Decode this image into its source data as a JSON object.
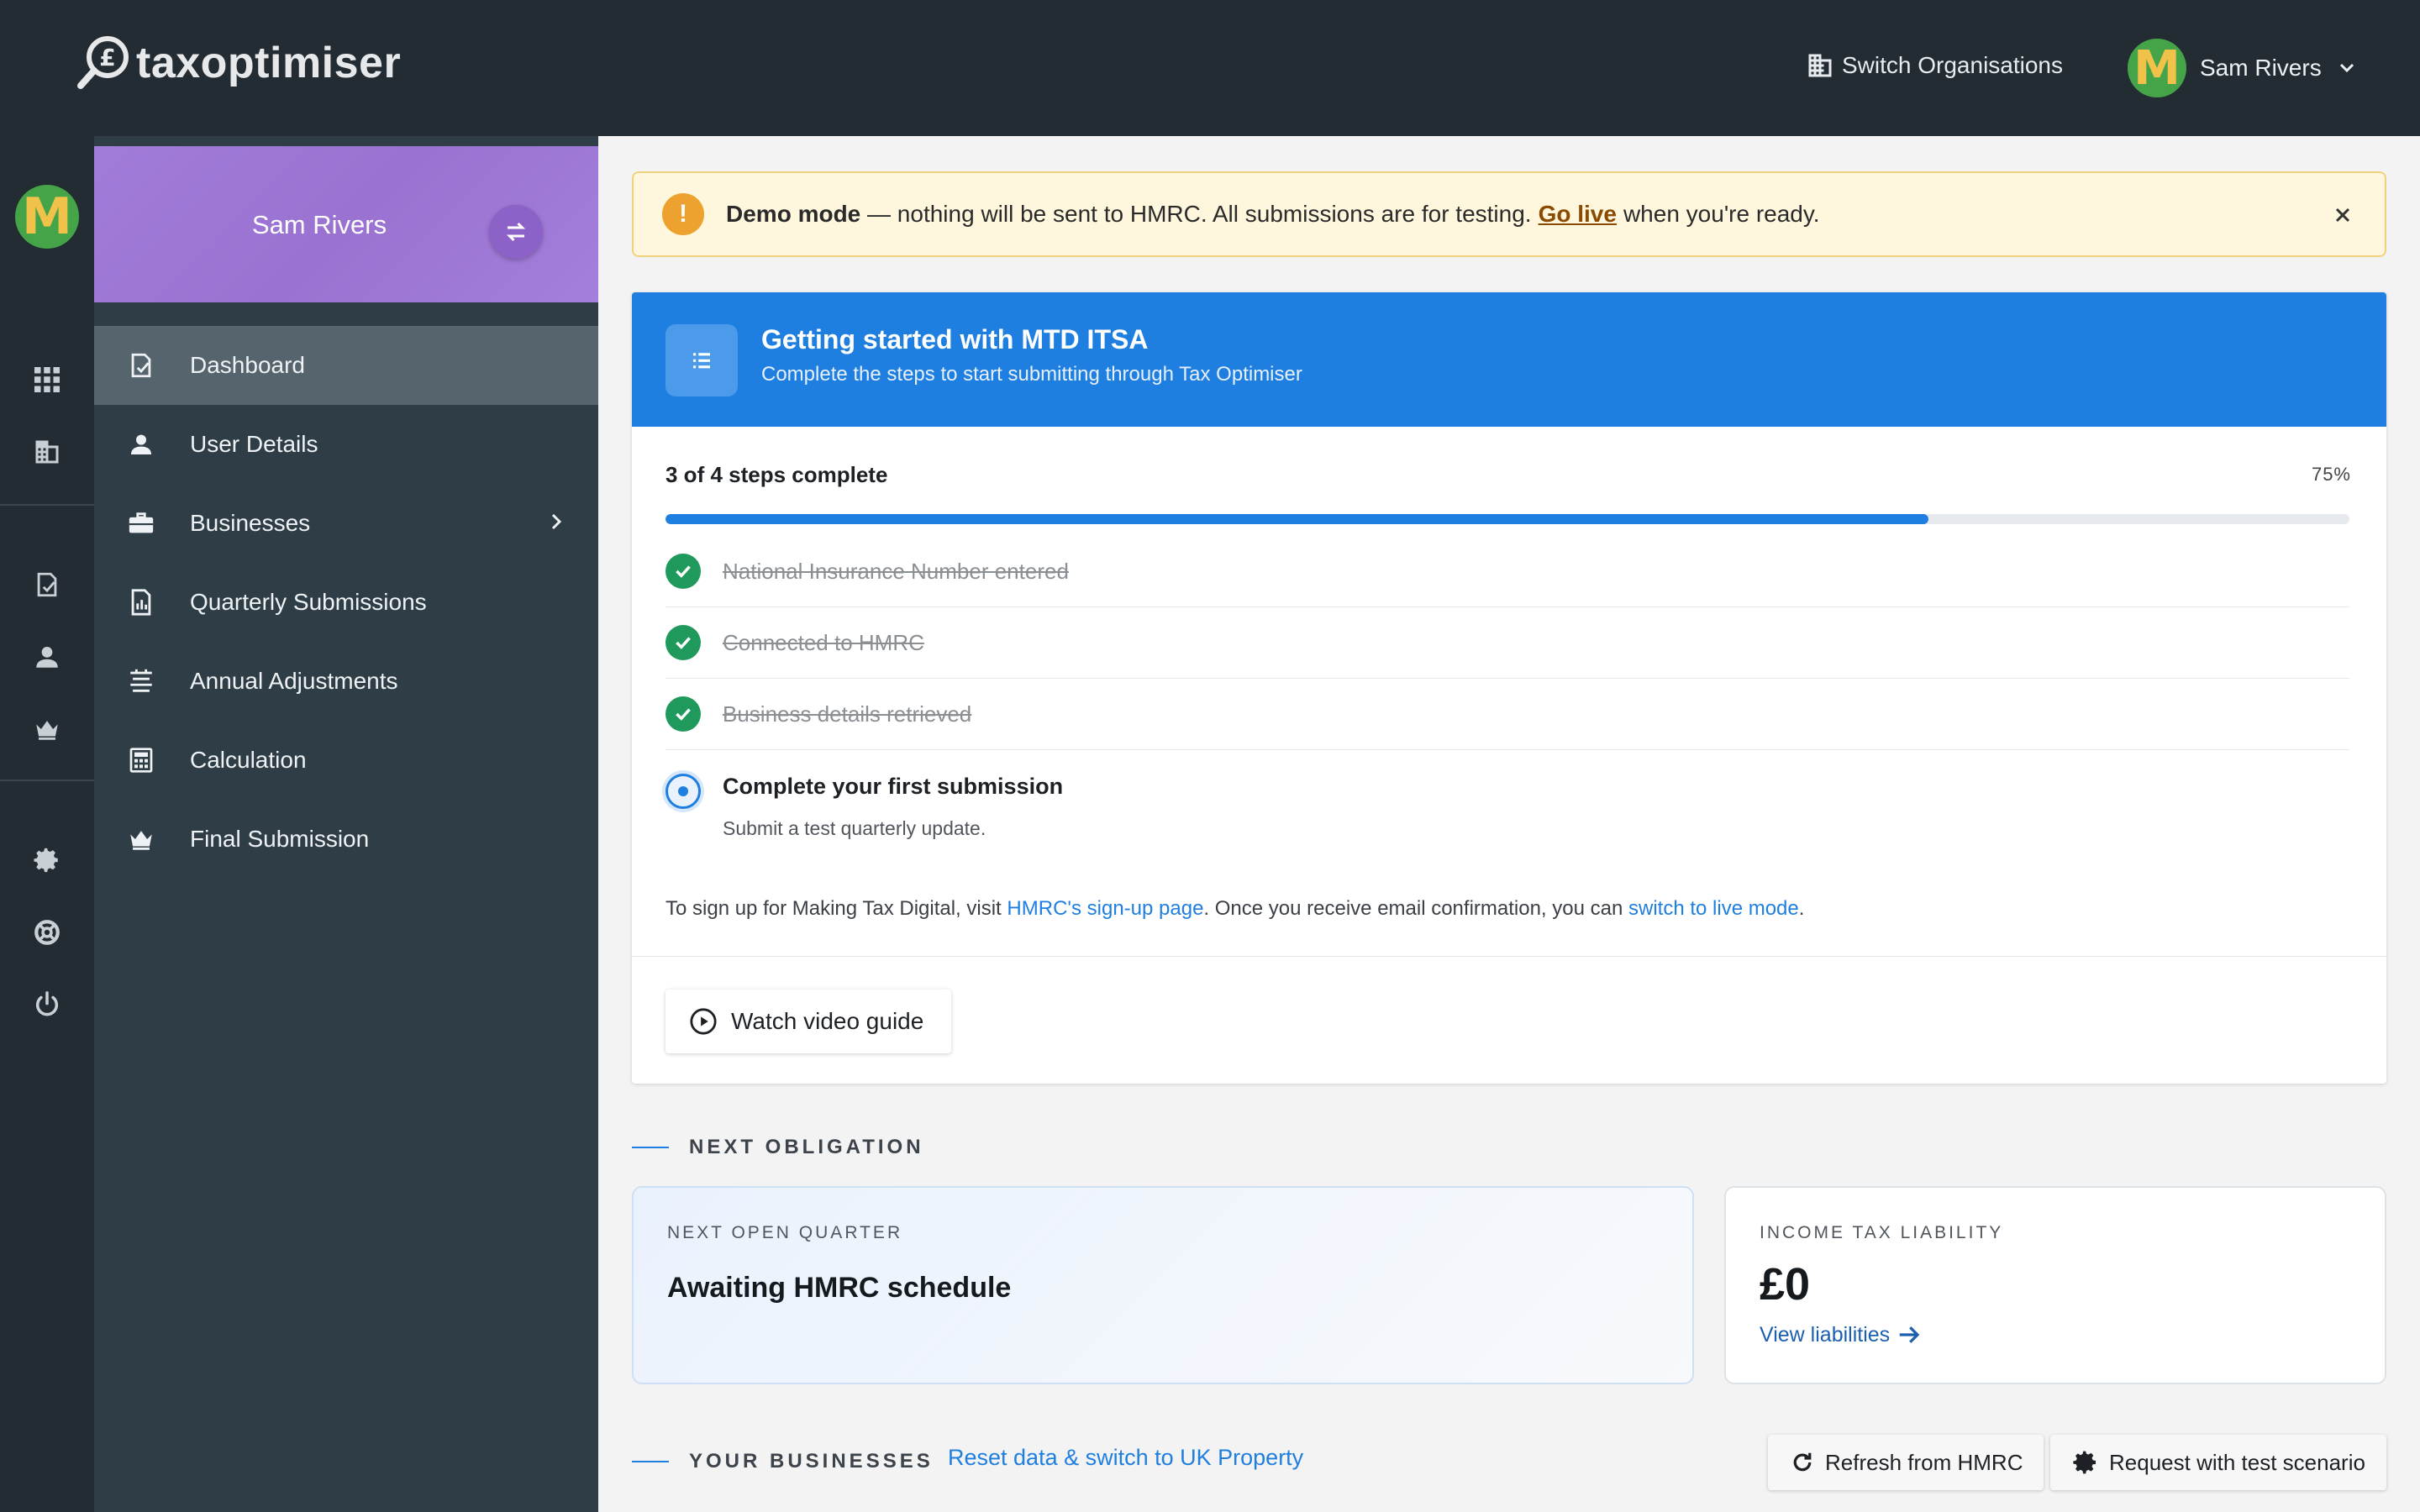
{
  "brand": {
    "name": "taxoptimiser"
  },
  "topbar": {
    "switch_org_label": "Switch Organisations",
    "user_name": "Sam Rivers",
    "avatar_letter": "M"
  },
  "rail": {
    "avatar_letter": "M"
  },
  "sidebar": {
    "user_name": "Sam Rivers",
    "items": [
      {
        "label": "Dashboard",
        "icon": "dashboard-icon",
        "active": true
      },
      {
        "label": "User Details",
        "icon": "user-icon"
      },
      {
        "label": "Businesses",
        "icon": "briefcase-icon",
        "has_submenu": true
      },
      {
        "label": "Quarterly Submissions",
        "icon": "report-icon"
      },
      {
        "label": "Annual Adjustments",
        "icon": "adjustments-icon"
      },
      {
        "label": "Calculation",
        "icon": "calculator-icon"
      },
      {
        "label": "Final Submission",
        "icon": "crown-icon"
      }
    ]
  },
  "banner": {
    "title": "Demo mode",
    "text": " — nothing will be sent to HMRC. All submissions are for testing.",
    "link": "Go live",
    "tail": "when you're ready."
  },
  "getting_started": {
    "title": "Getting started with MTD ITSA",
    "subtitle": "Complete the steps to start submitting through Tax Optimiser",
    "progress_label": "3 of 4 steps complete",
    "progress_pct_label": "75%",
    "progress": 0.75,
    "steps": [
      {
        "label": "National Insurance Number entered",
        "done": true
      },
      {
        "label": "Connected to HMRC",
        "done": true
      },
      {
        "label": "Business details retrieved",
        "done": true
      },
      {
        "label": "Complete your first submission",
        "sub": "Submit a test quarterly update.",
        "done": false
      }
    ],
    "signup_prefix": "To sign up for Making Tax Digital, visit ",
    "signup_link1": "HMRC's sign-up page",
    "signup_middle": ". Once you receive email confirmation, you can ",
    "signup_link2": "switch to live mode",
    "signup_suffix": ".",
    "video_button": "Watch video guide"
  },
  "next_obligation": {
    "section": "NEXT OBLIGATION",
    "kicker": "NEXT OPEN QUARTER",
    "title": "Awaiting HMRC schedule"
  },
  "tax_liability": {
    "kicker": "INCOME TAX LIABILITY",
    "value": "£0",
    "link": "View liabilities"
  },
  "businesses": {
    "section": "YOUR BUSINESSES",
    "reset_link": "Reset data & switch to UK Property",
    "refresh_button": "Refresh from HMRC",
    "test_button": "Request with test scenario"
  },
  "colors": {
    "accent": "#1f7fe0",
    "topbar": "#232c33",
    "sidebar": "#2f3e46",
    "sidebar_header": "#9f78d6",
    "success": "#1f9a5c",
    "warning": "#eda12e"
  }
}
